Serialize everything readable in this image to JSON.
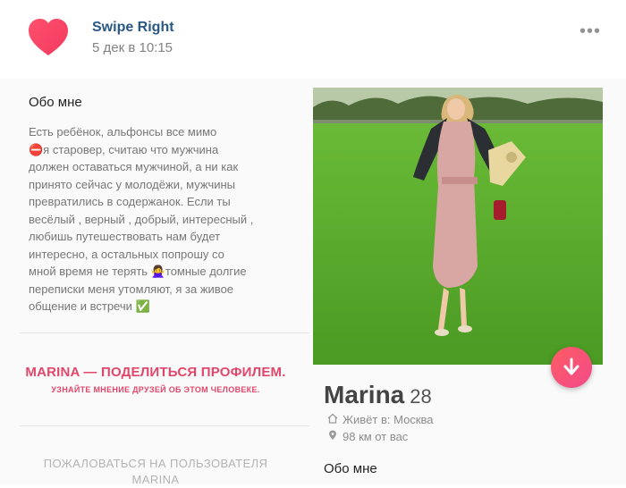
{
  "post": {
    "author": "Swipe Right",
    "date": "5 дек в 10:15",
    "more_icon": "•••",
    "brand_color": "#f5436b"
  },
  "profile": {
    "about_title": "Обо мне",
    "bio_lines": [
      "Есть ребёнок, альфонсы все мимо",
      "⛔я старовер, считаю что мужчина",
      "должен оставаться мужчиной, а ни как",
      "принято сейчас у молодёжи, мужчины",
      "превратились в содержанок. Если ты",
      "весёлый , верный , добрый, интересный ,",
      "любишь путешествовать нам будет",
      "интересно, а остальных попрошу со",
      "мной время не терять 🙅‍♀️томные долгие",
      "переписки меня утомляют, я за живое",
      "общение и встречи ✅"
    ],
    "share_title": "MARINA — ПОДЕЛИТЬСЯ ПРОФИЛЕМ.",
    "share_subtitle": "УЗНАЙТЕ МНЕНИЕ ДРУЗЕЙ ОБ ЭТОМ ЧЕЛОВЕКЕ.",
    "report_lines": [
      "ПОЖАЛОВАТЬСЯ НА ПОЛЬЗОВАТЕЛЯ",
      "MARINA"
    ],
    "name": "Marina",
    "age": "28",
    "lives_in": "Живёт в: Москва",
    "distance": "98 км от вас",
    "about_title_2": "Обо мне",
    "accent_color": "#e2466a"
  }
}
